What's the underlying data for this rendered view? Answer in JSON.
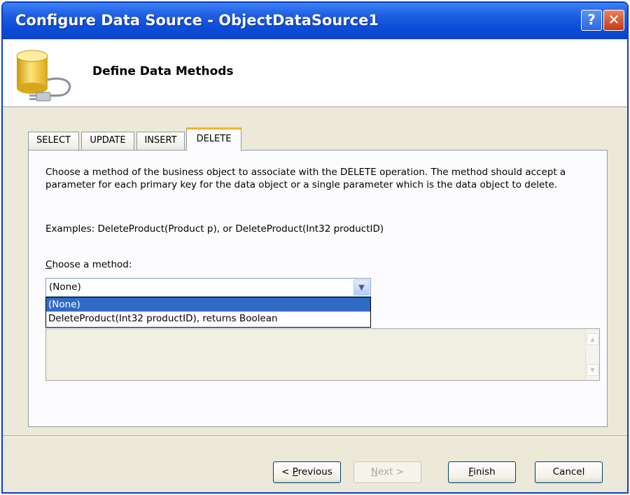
{
  "window": {
    "title": "Configure Data Source - ObjectDataSource1",
    "help_label": "?",
    "close_label": "✕"
  },
  "header": {
    "title": "Define Data Methods"
  },
  "tabs": [
    {
      "label": "SELECT",
      "active": false
    },
    {
      "label": "UPDATE",
      "active": false
    },
    {
      "label": "INSERT",
      "active": false
    },
    {
      "label": "DELETE",
      "active": true
    }
  ],
  "panel": {
    "description": "Choose a method of the business object to associate with the DELETE operation. The method should accept a parameter for each primary key for the data object or a single parameter which is the data object to delete.",
    "examples": "Examples: DeleteProduct(Product p), or DeleteProduct(Int32 productID)",
    "choose_label_mnemonic": "C",
    "choose_label_rest": "hoose a method:",
    "method_select": {
      "value": "(None)",
      "options": [
        "(None)",
        "DeleteProduct(Int32 productID), returns Boolean"
      ],
      "highlighted": "(None)"
    }
  },
  "buttons": {
    "previous": {
      "prefix": "< ",
      "mnemonic": "P",
      "rest": "revious"
    },
    "next": {
      "mnemonic": "N",
      "rest": "ext >"
    },
    "finish": {
      "mnemonic": "F",
      "rest": "inish"
    },
    "cancel": "Cancel"
  },
  "colors": {
    "titlebar": "#0b4cd8",
    "selection": "#316ac5",
    "active_tab_accent": "#f0b433"
  }
}
